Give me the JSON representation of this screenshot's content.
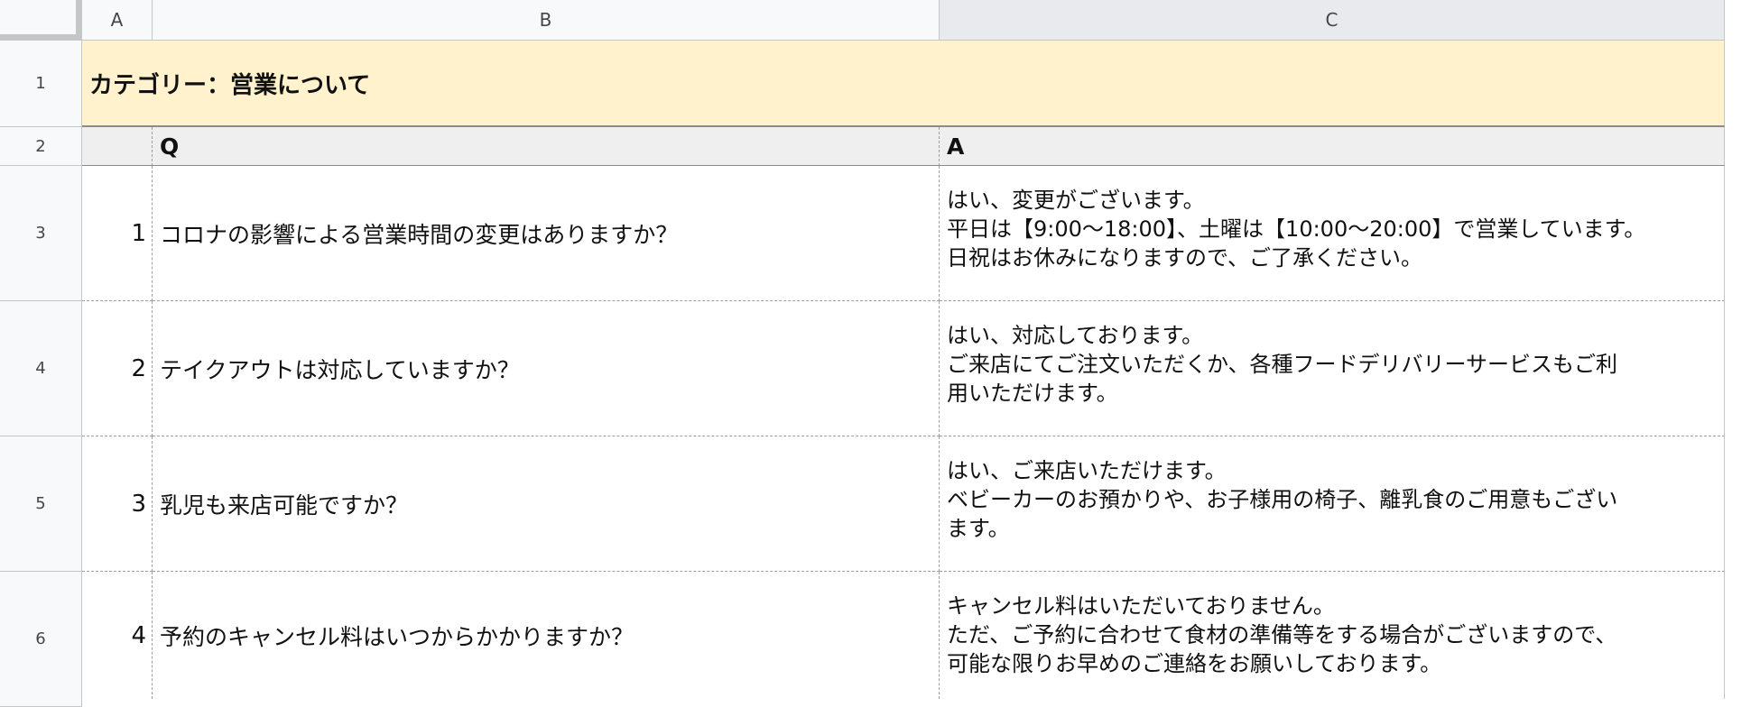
{
  "columns": [
    "A",
    "B",
    "C"
  ],
  "row_numbers": [
    "1",
    "2",
    "3",
    "4",
    "5",
    "6"
  ],
  "category_title": "カテゴリー：営業について",
  "header": {
    "q": "Q",
    "a": "A"
  },
  "rows": [
    {
      "num": "1",
      "question": "コロナの影響による営業時間の変更はありますか？",
      "answer_lines": [
        "はい、変更がございます。",
        "平日は【9:00〜18:00】、土曜は【10:00〜20:00】で営業しています。",
        "日祝はお休みになりますので、ご了承ください。"
      ]
    },
    {
      "num": "2",
      "question": "テイクアウトは対応していますか？",
      "answer_lines": [
        "はい、対応しております。",
        "ご来店にてご注文いただくか、各種フードデリバリーサービスもご利",
        "用いただけます。"
      ]
    },
    {
      "num": "3",
      "question": "乳児も来店可能ですか？",
      "answer_lines": [
        "はい、ご来店いただけます。",
        "ベビーカーのお預かりや、お子様用の椅子、離乳食のご用意もござい",
        "ます。"
      ]
    },
    {
      "num": "4",
      "question": "予約のキャンセル料はいつからかかりますか？",
      "answer_lines": [
        "キャンセル料はいただいておりません。",
        "ただ、ご予約に合わせて食材の準備等をする場合がございますので、",
        "可能な限りお早めのご連絡をお願いしております。"
      ]
    }
  ],
  "colors": {
    "category_bg": "#fff2cc",
    "header_bg": "#efefef",
    "selected_col_bg": "#e8eaed"
  }
}
